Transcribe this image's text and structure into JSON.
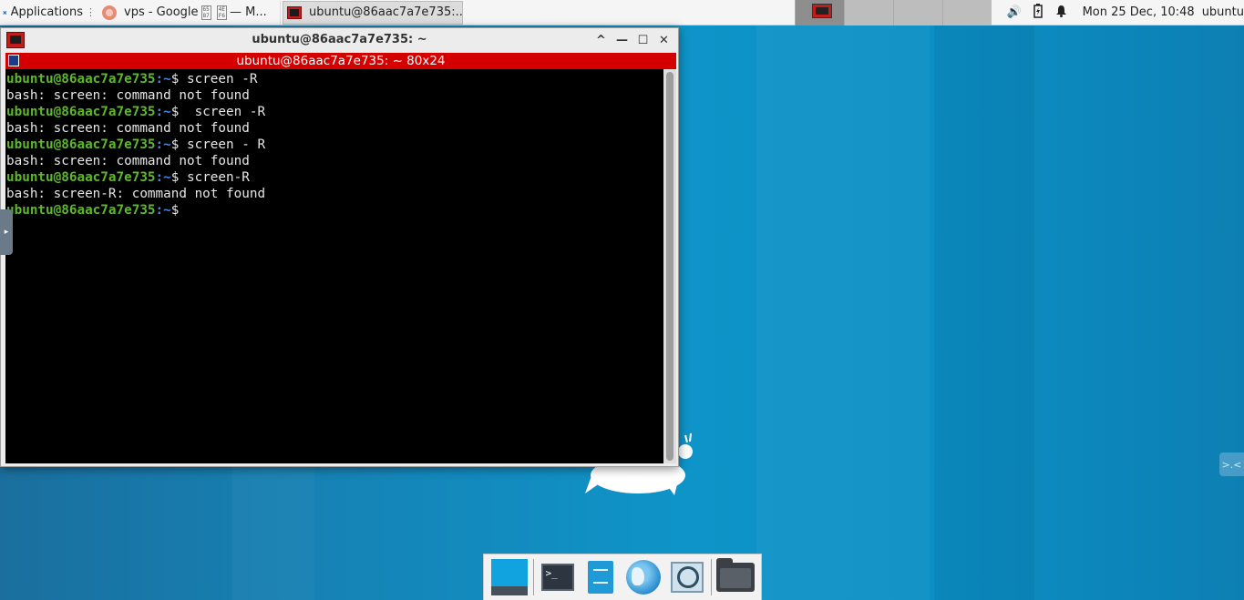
{
  "top_panel": {
    "applications_label": "Applications",
    "tasks": [
      {
        "label": "vps - Google",
        "suffix": "— M..."
      },
      {
        "label": "ubuntu@86aac7a7e735:..."
      }
    ],
    "hex_glyph": [
      "65",
      "87",
      "4E",
      "F6"
    ],
    "clock": "Mon 25 Dec, 10:48",
    "user": "ubuntu",
    "icons": [
      "volume-icon",
      "battery-icon",
      "notification-bell-icon"
    ]
  },
  "window": {
    "title": "ubuntu@86aac7a7e735: ~",
    "screen_bar": "ubuntu@86aac7a7e735: ~ 80x24",
    "controls": {
      "maximize_shade": "^",
      "minimize": "—",
      "maximize": "☐",
      "close": "✕"
    }
  },
  "terminal": {
    "lines": [
      {
        "type": "prompt",
        "user": "ubuntu@86aac7a7e735",
        "path": ":~",
        "cmd": "$ screen -R"
      },
      {
        "type": "output",
        "text": "bash: screen: command not found"
      },
      {
        "type": "prompt",
        "user": "ubuntu@86aac7a7e735",
        "path": ":~",
        "cmd": "$  screen -R"
      },
      {
        "type": "output",
        "text": "bash: screen: command not found"
      },
      {
        "type": "prompt",
        "user": "ubuntu@86aac7a7e735",
        "path": ":~",
        "cmd": "$ screen - R"
      },
      {
        "type": "output",
        "text": "bash: screen: command not found"
      },
      {
        "type": "prompt",
        "user": "ubuntu@86aac7a7e735",
        "path": ":~",
        "cmd": "$ screen-R"
      },
      {
        "type": "output",
        "text": "bash: screen-R: command not found"
      },
      {
        "type": "prompt",
        "user": "ubuntu@86aac7a7e735",
        "path": ":~",
        "cmd": "$"
      }
    ]
  },
  "dock": {
    "items": [
      "show-desktop",
      "terminal",
      "file-manager",
      "web-browser",
      "app-finder",
      "home-folder"
    ],
    "terminal_glyph": ">_"
  }
}
